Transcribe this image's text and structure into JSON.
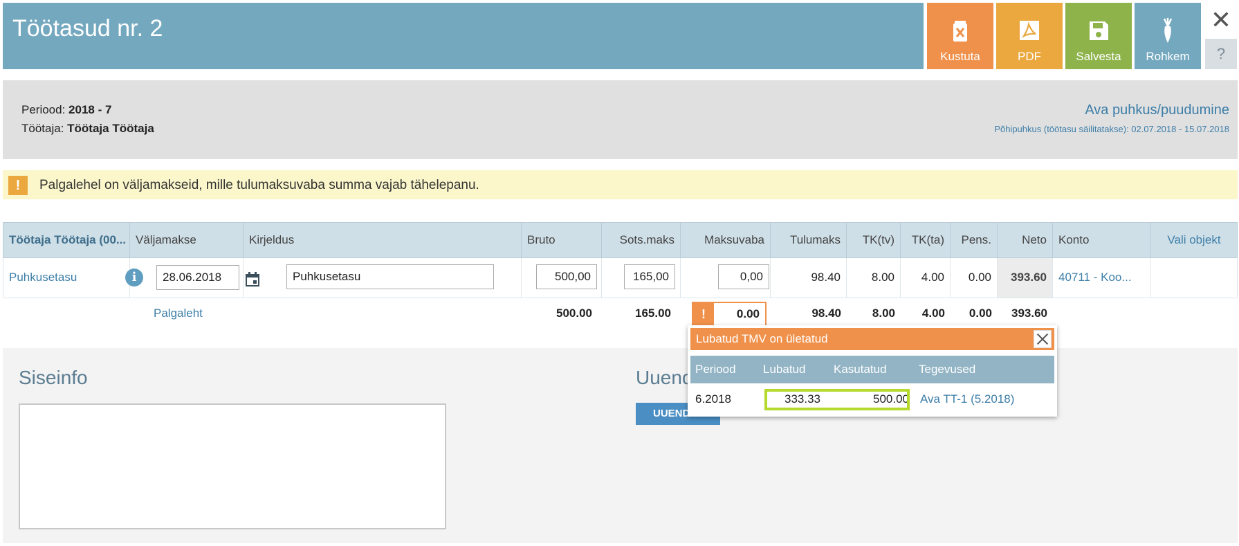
{
  "header": {
    "title": "Töötasud nr. 2",
    "buttons": {
      "delete": "Kustuta",
      "pdf": "PDF",
      "save": "Salvesta",
      "more": "Rohkem"
    },
    "close": "✕",
    "help": "?"
  },
  "info": {
    "period_label": "Periood: ",
    "period_value": "2018 - 7",
    "employee_label": "Töötaja: ",
    "employee_value": "Töötaja Töötaja",
    "vacation_link": "Ava puhkus/puudumine",
    "vacation_note": "Põhipuhkus (töötasu säilitatakse): 02.07.2018 - 15.07.2018"
  },
  "warning": {
    "icon": "!",
    "text": "Palgalehel on väljamakseid, mille tulumaksuvaba summa vajab tähelepanu."
  },
  "table": {
    "headers": {
      "employee": "Töötaja Töötaja (00...",
      "payout": "Väljamakse",
      "description": "Kirjeldus",
      "gross": "Bruto",
      "social": "Sots.maks",
      "taxfree": "Maksuvaba",
      "incometax": "Tulumaks",
      "tk_tv": "TK(tv)",
      "tk_ta": "TK(ta)",
      "pension": "Pens.",
      "net": "Neto",
      "account": "Konto",
      "object": "Vali objekt"
    },
    "row": {
      "type": "Puhkusetasu",
      "date": "28.06.2018",
      "description": "Puhkusetasu",
      "gross": "500,00",
      "social": "165,00",
      "taxfree": "0,00",
      "incometax": "98.40",
      "tk_tv": "8.00",
      "tk_ta": "4.00",
      "pension": "0.00",
      "net": "393.60",
      "account": "40711 - Koo..."
    },
    "totals": {
      "link": "Palgaleht",
      "gross": "500.00",
      "social": "165.00",
      "taxfree": "0.00",
      "incometax": "98.40",
      "tk_tv": "8.00",
      "tk_ta": "4.00",
      "pension": "0.00",
      "net": "393.60"
    }
  },
  "lower": {
    "internal_title": "Siseinfo",
    "updates_title": "Uuend",
    "updates_button": "UUEND"
  },
  "popup": {
    "title": "Lubatud TMV on ületatud",
    "columns": {
      "period": "Periood",
      "allowed": "Lubatud",
      "used": "Kasutatud",
      "actions": "Tegevused"
    },
    "row": {
      "period": "6.2018",
      "allowed": "333.33",
      "used": "500.00",
      "action": "Ava TT-1 (5.2018)"
    },
    "warn_icon": "!"
  },
  "colors": {
    "header": "#74a8bf",
    "delete": "#f0914b",
    "pdf": "#eaa83f",
    "save": "#8db34a",
    "link": "#3d7ea8",
    "highlight": "#b5d92c"
  },
  "icons": {
    "delete": "trash-icon",
    "pdf": "pdf-icon",
    "save": "floppy-icon",
    "more": "carrot-icon",
    "calendar": "calendar-icon",
    "info": "info-icon"
  }
}
